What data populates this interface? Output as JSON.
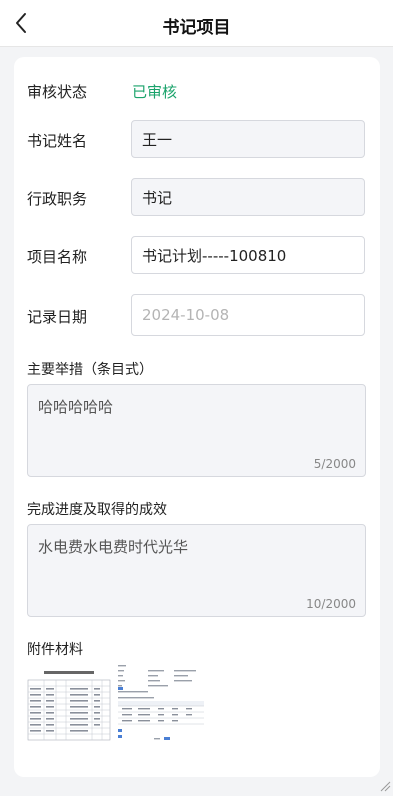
{
  "header": {
    "title": "书记项目"
  },
  "form": {
    "status": {
      "label": "审核状态",
      "value": "已审核",
      "color": "#1aa36b"
    },
    "secretary_name": {
      "label": "书记姓名",
      "value": "王一"
    },
    "position": {
      "label": "行政职务",
      "value": "书记"
    },
    "project_name": {
      "label": "项目名称",
      "value": "书记计划-----100810"
    },
    "record_date": {
      "label": "记录日期",
      "placeholder": "2024-10-08"
    }
  },
  "measures": {
    "title": "主要举措（条目式）",
    "value": "哈哈哈哈哈",
    "count": "5/2000"
  },
  "progress": {
    "title": "完成进度及取得的成效",
    "value": "水电费水电费时代光华",
    "count": "10/2000"
  },
  "attachments": {
    "title": "附件材料",
    "items": [
      "spreadsheet-thumbnail",
      "form-thumbnail"
    ]
  }
}
